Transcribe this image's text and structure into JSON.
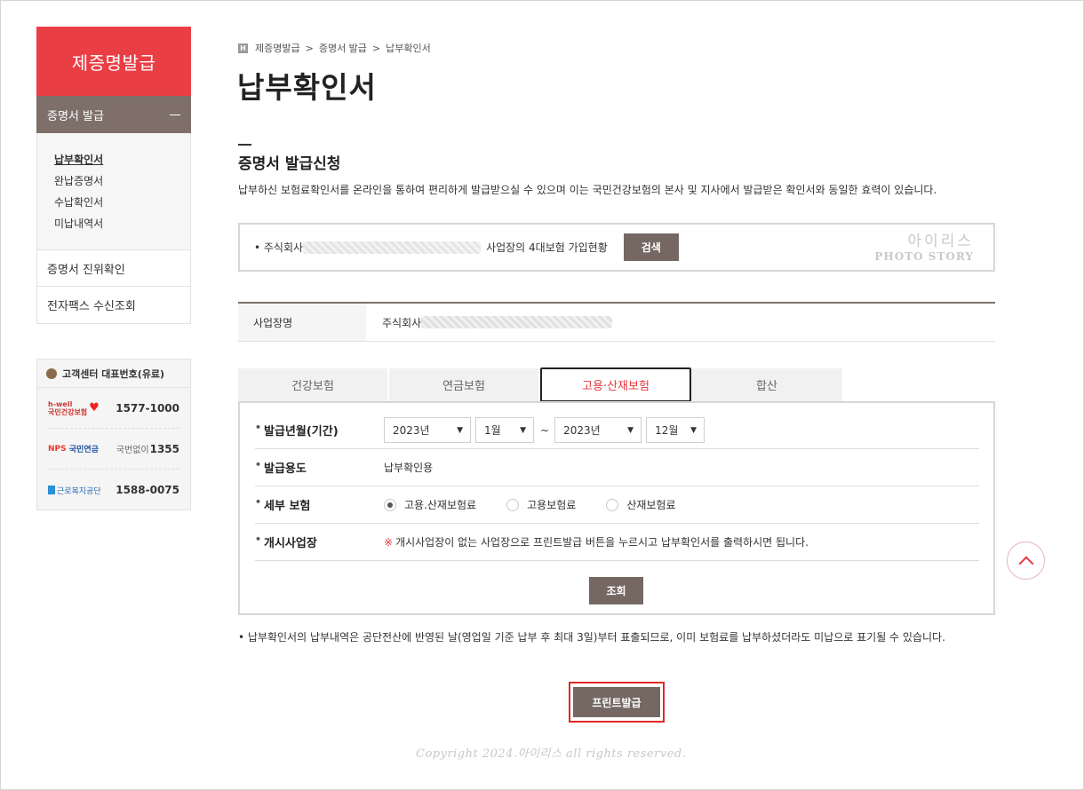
{
  "sidebar": {
    "title": "제증명발급",
    "section": "증명서 발급",
    "sub_items": [
      "납부확인서",
      "완납증명서",
      "수납확인서",
      "미납내역서"
    ],
    "links": [
      "증명서 진위확인",
      "전자팩스 수신조회"
    ]
  },
  "customer_center": {
    "title": "고객센터 대표번호(유료)",
    "rows": [
      {
        "logo_top": "h-well",
        "logo": "국민건강보험",
        "number": "1577-1000",
        "prefix": ""
      },
      {
        "logo_top": "NPS",
        "logo": "국민연금",
        "number": "1355",
        "prefix": "국번없이"
      },
      {
        "logo_top": "",
        "logo": "근로복지공단",
        "number": "1588-0075",
        "prefix": ""
      }
    ]
  },
  "breadcrumb": {
    "home": "H",
    "items": [
      "제증명발급",
      "증명서 발급",
      "납부확인서"
    ]
  },
  "page": {
    "title": "납부확인서",
    "section_title": "증명서 발급신청",
    "description": "납부하신 보험료확인서를 온라인을 통하여 편리하게 발급받으실 수 있으며 이는 국민건강보험의 본사 및 지사에서 발급받은 확인서와 동일한 효력이 있습니다."
  },
  "search": {
    "prefix": "• 주식회사",
    "suffix": "사업장의 4대보험 가입현황",
    "button": "검색"
  },
  "watermark": {
    "line1": "아이리스",
    "line2": "PHOTO STORY"
  },
  "info": {
    "label": "사업장명",
    "value_prefix": "주식회사"
  },
  "tabs": [
    "건강보험",
    "연금보험",
    "고용·산재보험",
    "합산"
  ],
  "form": {
    "period_label": "발급년월(기간)",
    "from_year": "2023년",
    "from_month": "1월",
    "tilde": "~",
    "to_year": "2023년",
    "to_month": "12월",
    "purpose_label": "발급용도",
    "purpose_value": "납부확인용",
    "detail_label": "세부 보험",
    "radio_options": [
      "고용.산재보험료",
      "고용보험료",
      "산재보험료"
    ],
    "site_label": "개시사업장",
    "site_mark": "※",
    "site_notice": "개시사업장이 없는 사업장으로 프린트발급 버튼을 누르시고 납부확인서를 출력하시면 됩니다.",
    "query_button": "조회"
  },
  "note": "• 납부확인서의 납부내역은 공단전산에 반영된 날(영업일 기준 납부 후 최대 3일)부터 표출되므로, 이미 보험료를 납부하셨더라도 미납으로 표기될 수 있습니다.",
  "print_button": "프린트발급",
  "copyright": "Copyright 2024.아이리스 all rights reserved."
}
